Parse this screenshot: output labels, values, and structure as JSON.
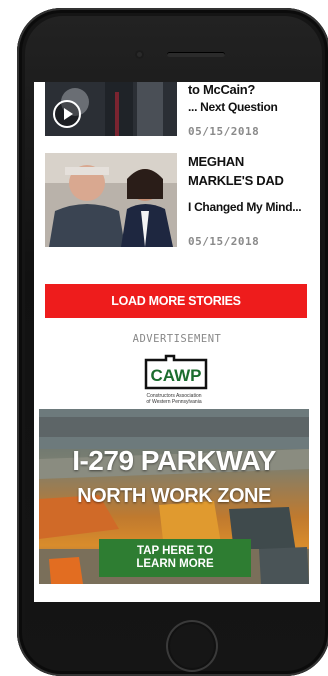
{
  "stories": [
    {
      "headline": "to McCain?",
      "subline": "... Next Question",
      "date": "05/15/2018",
      "has_video": true
    },
    {
      "headline_line1": "MEGHAN",
      "headline_line2": "MARKLE'S DAD",
      "subline": "I Changed My Mind...",
      "date": "05/15/2018"
    }
  ],
  "load_more_label": "LOAD MORE STORIES",
  "advertisement_label": "ADVERTISEMENT",
  "ad": {
    "brand": "CAWP",
    "brand_tagline_1": "Constructors Association",
    "brand_tagline_2": "of Western Pennsylvania",
    "title_line1": "I-279 PARKWAY",
    "title_line2": "NORTH WORK ZONE",
    "cta_line1": "TAP HERE TO",
    "cta_line2": "LEARN MORE"
  },
  "colors": {
    "load_more_bg": "#ee1c1c",
    "cta_bg": "#2e7d32",
    "date_text": "#8a8a8a"
  }
}
